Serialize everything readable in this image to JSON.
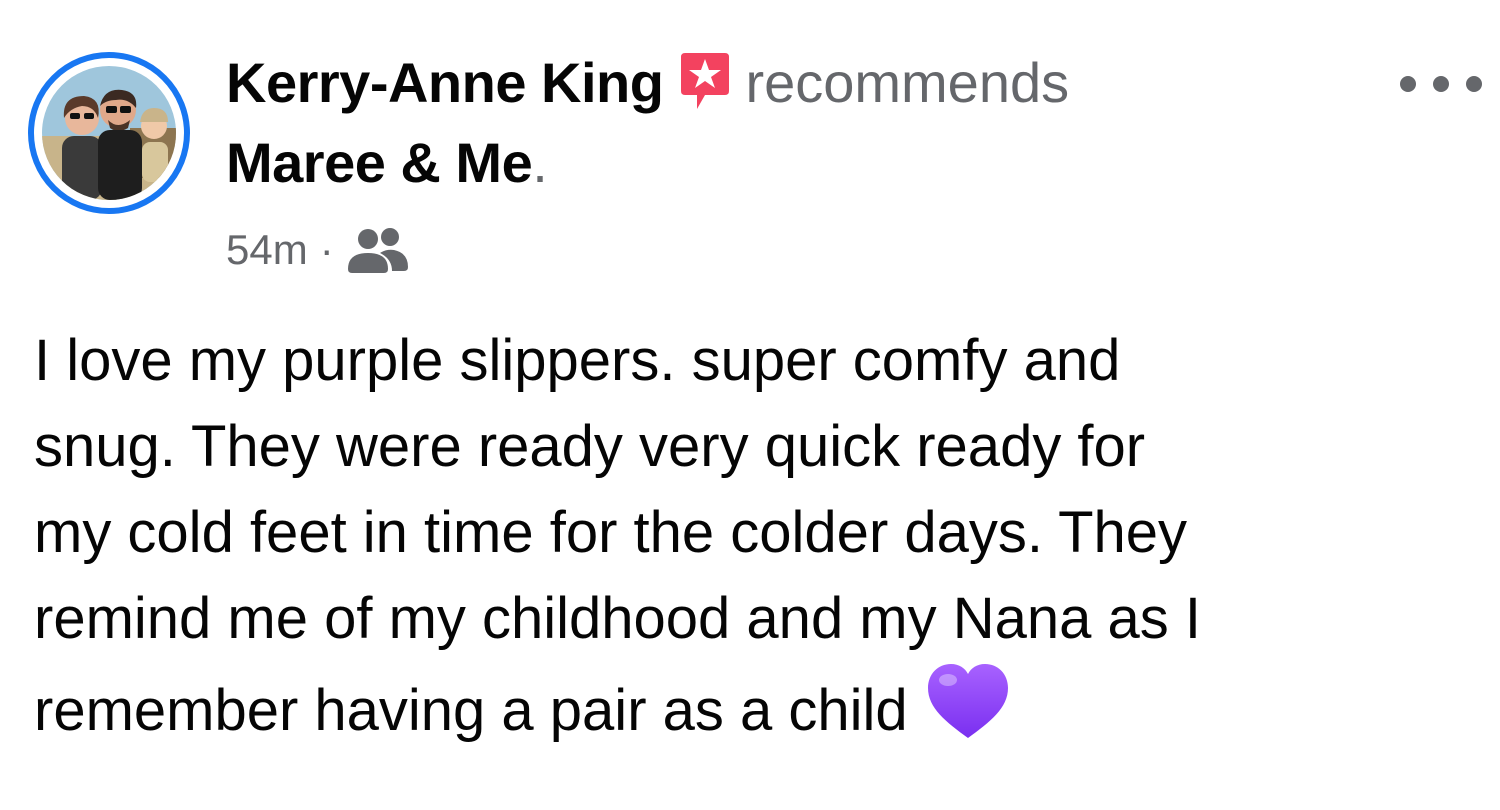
{
  "post": {
    "author": "Kerry-Anne King",
    "action": "recommends",
    "page_name": "Maree & Me",
    "page_name_suffix": ".",
    "time": "54m",
    "separator": "·",
    "audience_icon": "friends-icon",
    "badge_icon": "recommendation-star-icon",
    "more_icon": "more-options-icon",
    "text": "I love my purple slippers. super comfy and\nsnug. They were ready very quick ready for\nmy cold feet in time for the colder days. They\nremind me of my childhood and my Nana as I\nremember having a pair as a child",
    "emoji": "purple-heart",
    "colors": {
      "ring": "#1877f2",
      "badge": "#f3425f",
      "secondary_text": "#65676b",
      "heart": "#8a3ffc"
    }
  }
}
